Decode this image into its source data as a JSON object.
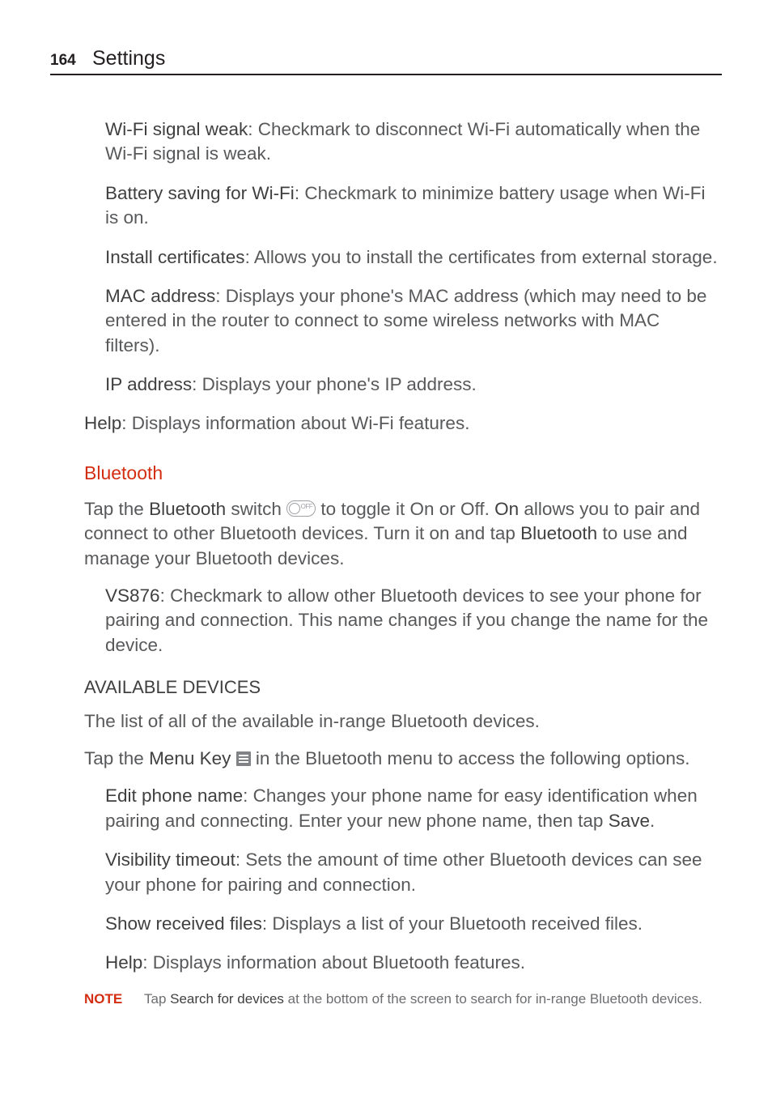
{
  "header": {
    "page_number": "164",
    "title": "Settings"
  },
  "wifi_items": [
    {
      "term": "Wi-Fi signal weak",
      "desc": ": Checkmark to disconnect Wi-Fi automatically when the Wi-Fi signal is weak."
    },
    {
      "term": "Battery saving for Wi-Fi",
      "desc": ": Checkmark to minimize battery usage when Wi-Fi is on."
    },
    {
      "term": "Install certificates",
      "desc": ": Allows you to install the certificates from external storage."
    },
    {
      "term": "MAC address",
      "desc": ": Displays your phone's MAC address (which may need to be entered in the router to connect to some wireless networks with MAC filters)."
    },
    {
      "term": "IP address",
      "desc": ": Displays your phone's IP address."
    }
  ],
  "wifi_help": {
    "term": "Help",
    "desc": ": Displays information about Wi-Fi features."
  },
  "bluetooth": {
    "heading": "Bluetooth",
    "intro_pre": "Tap the ",
    "intro_b1": "Bluetooth",
    "intro_mid1": " switch ",
    "intro_mid2": " to toggle it On or Off. ",
    "intro_b2": "On",
    "intro_mid3": " allows you to pair and connect to other Bluetooth devices. Turn it on and tap ",
    "intro_b3": "Bluetooth",
    "intro_end": " to use and manage your Bluetooth devices.",
    "vs876": {
      "term": "VS876",
      "desc": ": Checkmark to allow other Bluetooth devices to see your phone for pairing and connection. This name changes if you change the name for the device."
    },
    "avail_heading": "AVAILABLE DEVICES",
    "avail_desc": "The list of all of the available in-range Bluetooth devices.",
    "menu_pre": "Tap the ",
    "menu_b1": "Menu Key",
    "menu_mid": " ",
    "menu_end": " in the Bluetooth menu to access the following options.",
    "options": [
      {
        "term": "Edit phone name",
        "desc_pre": ": Changes your phone name for easy identification when pairing and connecting. Enter your new phone name, then tap ",
        "tail_bold": "Save",
        "tail": "."
      },
      {
        "term": "Visibility timeout",
        "desc_pre": ": Sets the amount of time other Bluetooth devices can see your phone for pairing and connection.",
        "tail_bold": "",
        "tail": ""
      },
      {
        "term": "Show received files",
        "desc_pre": ": Displays a list of your Bluetooth received files.",
        "tail_bold": "",
        "tail": ""
      },
      {
        "term": "Help",
        "desc_pre": ": Displays information about Bluetooth features.",
        "tail_bold": "",
        "tail": ""
      }
    ]
  },
  "note": {
    "label": "NOTE",
    "pre": "Tap ",
    "bold": "Search for devices",
    "post": " at the bottom of the screen to search for in-range Bluetooth devices."
  }
}
